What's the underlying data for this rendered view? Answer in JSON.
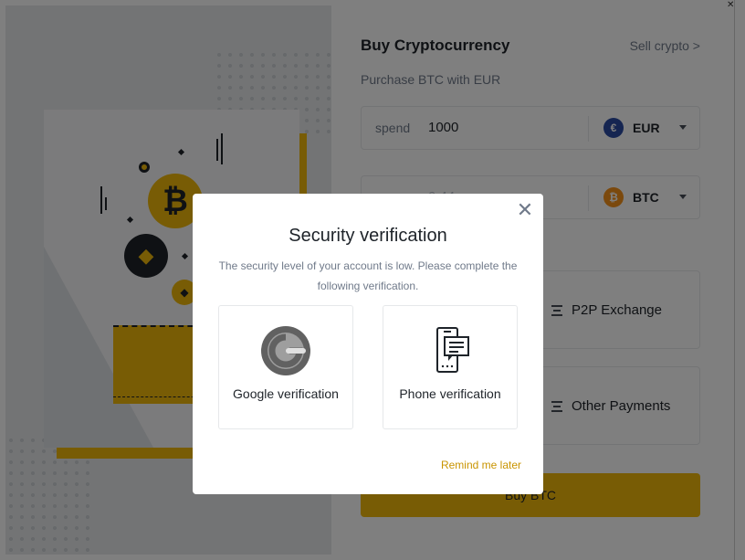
{
  "buy_panel": {
    "title": "Buy Cryptocurrency",
    "sell_link": "Sell crypto >",
    "subtitle": "Purchase BTC with EUR",
    "spend": {
      "label": "spend",
      "value": "1000",
      "currency": "EUR",
      "currency_icon": "euro-icon"
    },
    "receive": {
      "value": "0.44",
      "currency": "BTC",
      "currency_icon": "bitcoin-icon"
    },
    "payment_methods": [
      {
        "label": "P2P Exchange",
        "icon": "list-icon"
      },
      {
        "label": "Other Payments",
        "icon": "list-icon"
      }
    ],
    "buy_button": "Buy BTC"
  },
  "modal": {
    "title": "Security verification",
    "description": "The security level of your account is low. Please complete the following verification.",
    "options": [
      {
        "label": "Google verification",
        "icon": "google-authenticator-icon"
      },
      {
        "label": "Phone verification",
        "icon": "phone-message-icon"
      }
    ],
    "remind_later": "Remind me later",
    "close_icon": "close-icon"
  },
  "colors": {
    "brand": "#f0b90b",
    "link": "#c99400",
    "text": "#1e2329",
    "muted": "#707a8a"
  }
}
